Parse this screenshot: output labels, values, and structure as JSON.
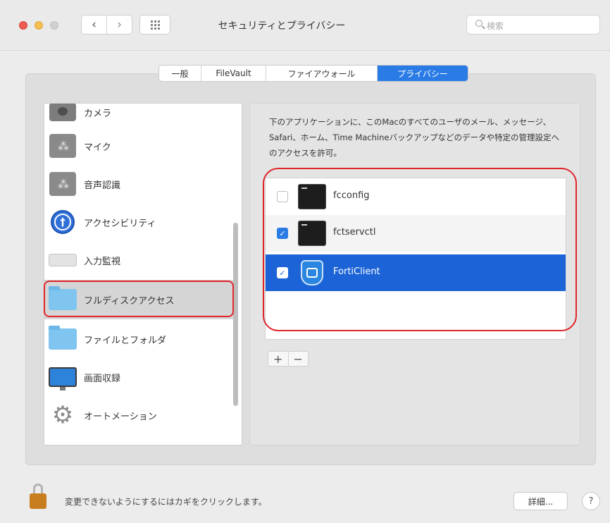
{
  "window": {
    "title": "セキュリティとプライバシー",
    "search_placeholder": "検索",
    "nav_back": "‹",
    "nav_forward": "›"
  },
  "tabs": [
    {
      "label": "一般",
      "active": false
    },
    {
      "label": "FileVault",
      "active": false
    },
    {
      "label": "ファイアウォール",
      "active": false
    },
    {
      "label": "プライバシー",
      "active": true
    }
  ],
  "sidebar": {
    "items": [
      {
        "label": "カメラ",
        "icon": "camera-icon"
      },
      {
        "label": "マイク",
        "icon": "microphone-icon"
      },
      {
        "label": "音声認識",
        "icon": "speech-recognition-icon"
      },
      {
        "label": "アクセシビリティ",
        "icon": "accessibility-icon"
      },
      {
        "label": "入力監視",
        "icon": "keyboard-icon"
      },
      {
        "label": "フルディスクアクセス",
        "icon": "folder-icon",
        "selected": true
      },
      {
        "label": "ファイルとフォルダ",
        "icon": "folder-icon"
      },
      {
        "label": "画面収録",
        "icon": "display-icon"
      },
      {
        "label": "オートメーション",
        "icon": "gear-icon"
      }
    ]
  },
  "description": "下のアプリケーションに、このMacのすべてのユーザのメール、メッセージ、Safari、ホーム、Time Machineバックアップなどのデータや特定の管理設定へのアクセスを許可。",
  "apps": [
    {
      "name": "fcconfig",
      "checked": false,
      "icon": "terminal-icon"
    },
    {
      "name": "fctservctl",
      "checked": true,
      "icon": "terminal-icon"
    },
    {
      "name": "FortiClient",
      "checked": true,
      "icon": "forticlient-shield-icon",
      "selected": true
    }
  ],
  "list_controls": {
    "add": "+",
    "remove": "−"
  },
  "footer": {
    "lock_text": "変更できないようにするにはカギをクリックします。",
    "details_button": "詳細...",
    "help_button": "?"
  },
  "colors": {
    "accent": "#1b63d6",
    "annotation_red": "#e0262a",
    "folder": "#7fc5f0"
  }
}
